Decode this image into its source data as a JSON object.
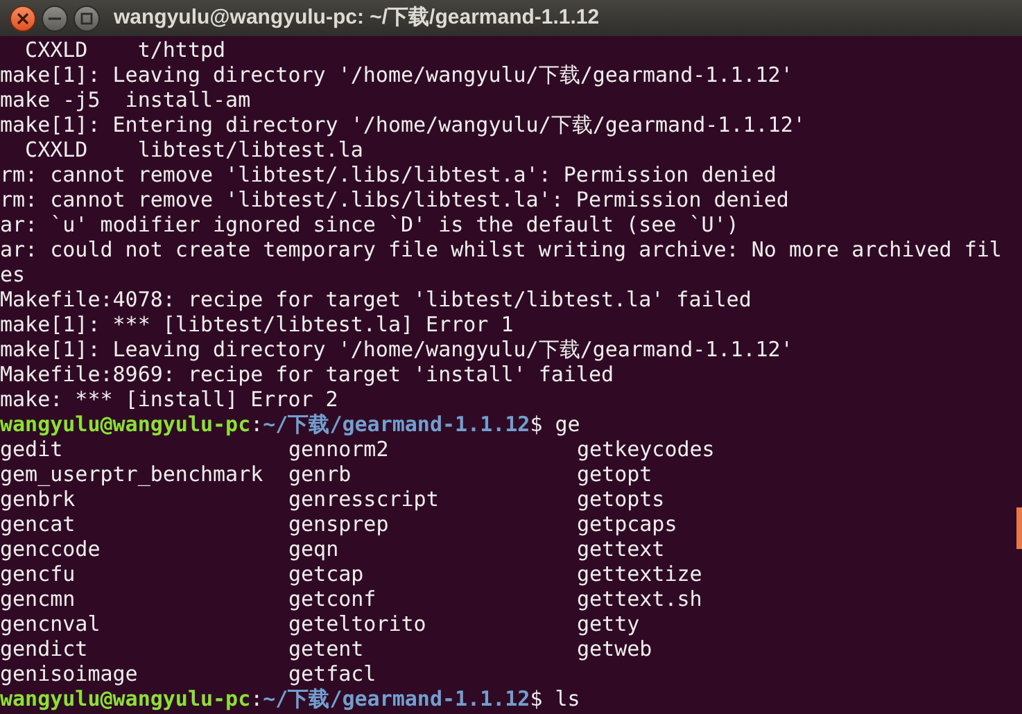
{
  "window": {
    "title": "wangyulu@wangyulu-pc: ~/下载/gearmand-1.1.12"
  },
  "output_lines": [
    "  CXXLD    t/httpd",
    "make[1]: Leaving directory '/home/wangyulu/下载/gearmand-1.1.12'",
    "make -j5  install-am",
    "make[1]: Entering directory '/home/wangyulu/下载/gearmand-1.1.12'",
    "  CXXLD    libtest/libtest.la",
    "rm: cannot remove 'libtest/.libs/libtest.a': Permission denied",
    "rm: cannot remove 'libtest/.libs/libtest.la': Permission denied",
    "ar: `u' modifier ignored since `D' is the default (see `U')",
    "ar: could not create temporary file whilst writing archive: No more archived fil",
    "es",
    "Makefile:4078: recipe for target 'libtest/libtest.la' failed",
    "make[1]: *** [libtest/libtest.la] Error 1",
    "make[1]: Leaving directory '/home/wangyulu/下载/gearmand-1.1.12'",
    "Makefile:8969: recipe for target 'install' failed",
    "make: *** [install] Error 2"
  ],
  "prompt_1": [
    {
      "kind": "user",
      "text": "wangyulu@wangyulu-pc"
    },
    {
      "kind": "plain",
      "text": ":"
    },
    {
      "kind": "path",
      "text": "~/下载/gearmand-1.1.12"
    },
    {
      "kind": "plain",
      "text": "$ ge"
    }
  ],
  "completions": [
    [
      "gedit",
      "gennorm2",
      "getkeycodes"
    ],
    [
      "gem_userptr_benchmark",
      "genrb",
      "getopt"
    ],
    [
      "genbrk",
      "genresscript",
      "getopts"
    ],
    [
      "gencat",
      "gensprep",
      "getpcaps"
    ],
    [
      "genccode",
      "geqn",
      "gettext"
    ],
    [
      "gencfu",
      "getcap",
      "gettextize"
    ],
    [
      "gencmn",
      "getconf",
      "gettext.sh"
    ],
    [
      "gencnval",
      "geteltorito",
      "getty"
    ],
    [
      "gendict",
      "getent",
      "getweb"
    ],
    [
      "genisoimage",
      "getfacl"
    ]
  ],
  "prompt_2": [
    {
      "kind": "user",
      "text": "wangyulu@wangyulu-pc"
    },
    {
      "kind": "plain",
      "text": ":"
    },
    {
      "kind": "path",
      "text": "~/下载/gearmand-1.1.12"
    },
    {
      "kind": "plain",
      "text": "$ ls"
    }
  ]
}
